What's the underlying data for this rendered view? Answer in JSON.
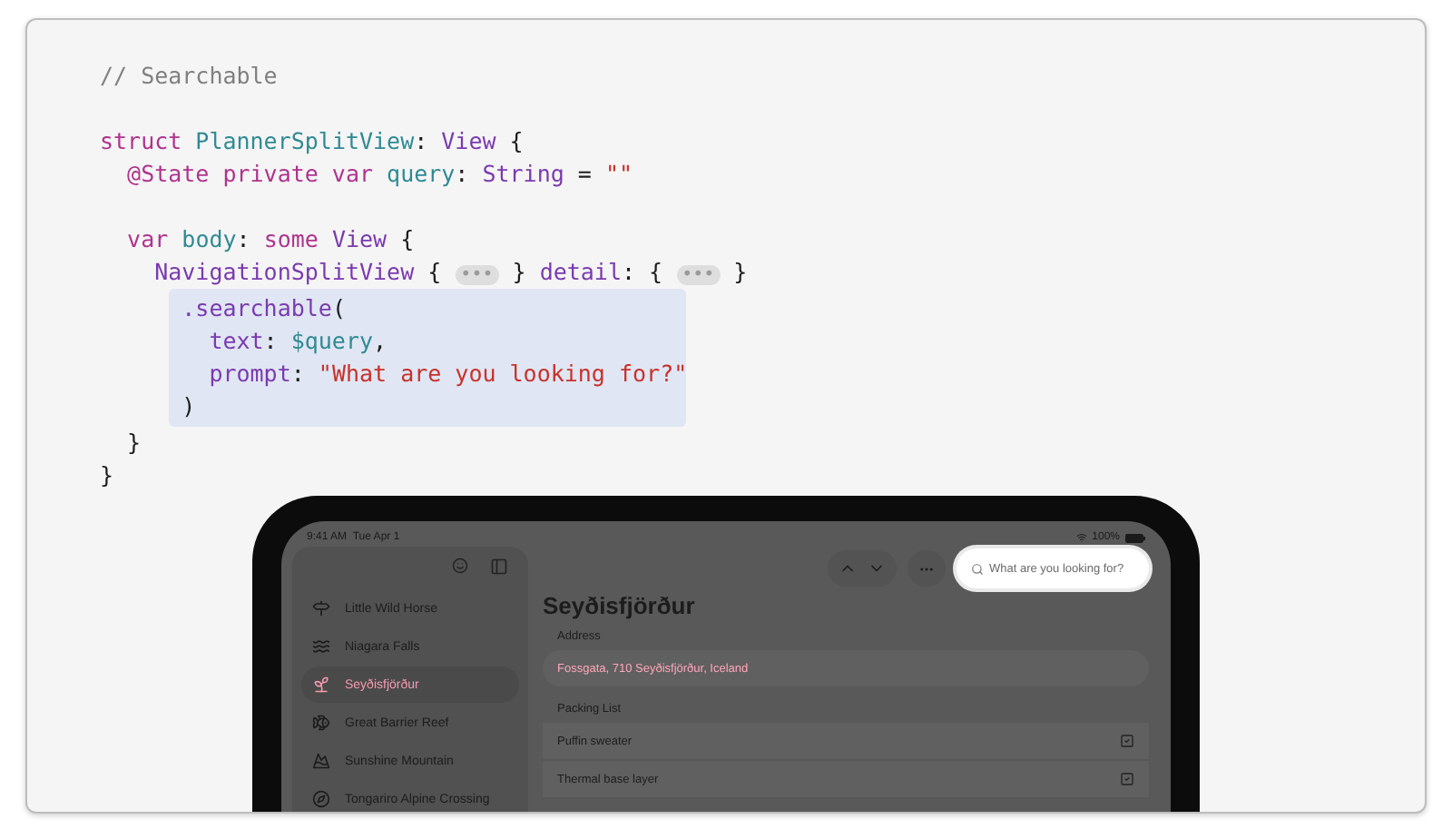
{
  "code": {
    "blocks": [
      {
        "highlighted": false,
        "lines": [
          {
            "kind": "code",
            "tokens": [
              {
                "kind": "comment",
                "text": "// Searchable"
              }
            ]
          },
          {
            "kind": "blank"
          },
          {
            "kind": "code",
            "tokens": [
              {
                "kind": "keyword",
                "text": "struct"
              },
              {
                "kind": "name",
                "text": " PlannerSplitView"
              },
              {
                "kind": "plain",
                "text": ": "
              },
              {
                "kind": "type",
                "text": "View"
              },
              {
                "kind": "plain",
                "text": " {"
              }
            ]
          },
          {
            "kind": "code",
            "tokens": [
              {
                "kind": "keyword",
                "text": "  @State private var"
              },
              {
                "kind": "name",
                "text": " query"
              },
              {
                "kind": "plain",
                "text": ": "
              },
              {
                "kind": "type",
                "text": "String"
              },
              {
                "kind": "plain",
                "text": " = "
              },
              {
                "kind": "string",
                "text": "\"\""
              }
            ]
          },
          {
            "kind": "blank"
          },
          {
            "kind": "code",
            "tokens": [
              {
                "kind": "keyword",
                "text": "  var"
              },
              {
                "kind": "name",
                "text": " body"
              },
              {
                "kind": "plain",
                "text": ": "
              },
              {
                "kind": "keyword",
                "text": "some"
              },
              {
                "kind": "type",
                "text": " View"
              },
              {
                "kind": "plain",
                "text": " {"
              }
            ]
          },
          {
            "kind": "code",
            "tokens": [
              {
                "kind": "type",
                "text": "    NavigationSplitView"
              },
              {
                "kind": "plain",
                "text": " { "
              },
              {
                "kind": "pill",
                "text": "•••"
              },
              {
                "kind": "plain",
                "text": " } "
              },
              {
                "kind": "type",
                "text": "detail"
              },
              {
                "kind": "plain",
                "text": ": { "
              },
              {
                "kind": "pill",
                "text": "•••"
              },
              {
                "kind": "plain",
                "text": " }"
              }
            ]
          }
        ]
      },
      {
        "highlighted": true,
        "lines": [
          {
            "kind": "code",
            "tokens": [
              {
                "kind": "type",
                "text": "      .searchable"
              },
              {
                "kind": "plain",
                "text": "("
              }
            ]
          },
          {
            "kind": "code",
            "tokens": [
              {
                "kind": "type",
                "text": "        text"
              },
              {
                "kind": "plain",
                "text": ": "
              },
              {
                "kind": "name",
                "text": "$query"
              },
              {
                "kind": "plain",
                "text": ","
              }
            ]
          },
          {
            "kind": "code",
            "tokens": [
              {
                "kind": "type",
                "text": "        prompt"
              },
              {
                "kind": "plain",
                "text": ": "
              },
              {
                "kind": "string",
                "text": "\"What are you looking for?\""
              }
            ]
          },
          {
            "kind": "code",
            "tokens": [
              {
                "kind": "plain",
                "text": "      )"
              }
            ]
          }
        ]
      },
      {
        "highlighted": false,
        "lines": [
          {
            "kind": "code",
            "tokens": [
              {
                "kind": "plain",
                "text": "  }"
              }
            ]
          },
          {
            "kind": "code",
            "tokens": [
              {
                "kind": "plain",
                "text": "}"
              }
            ]
          }
        ]
      }
    ]
  },
  "tablet": {
    "status_bar": {
      "time": "9:41 AM",
      "date": "Tue Apr 1",
      "battery": "100%"
    },
    "sidebar": {
      "items": [
        {
          "label": "Little Wild Horse",
          "selected": false
        },
        {
          "label": "Niagara Falls",
          "selected": false
        },
        {
          "label": "Seyðisfjörður",
          "selected": true
        },
        {
          "label": "Great Barrier Reef",
          "selected": false
        },
        {
          "label": "Sunshine Mountain",
          "selected": false
        },
        {
          "label": "Tongariro Alpine Crossing",
          "selected": false
        }
      ]
    },
    "search": {
      "placeholder": "What are you looking for?"
    },
    "detail": {
      "title": "Seyðisfjörður",
      "address_label": "Address",
      "address": "Fossgata, 710 Seyðisfjörður, Iceland",
      "packing_label": "Packing List",
      "packing": [
        {
          "label": "Puffin sweater",
          "checked": true
        },
        {
          "label": "Thermal base layer",
          "checked": true
        }
      ]
    }
  }
}
